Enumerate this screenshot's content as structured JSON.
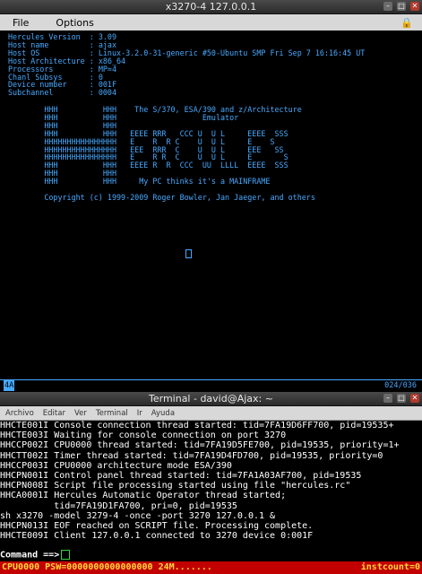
{
  "x3270": {
    "title": "x3270-4 127.0.0.1",
    "menu": [
      "File",
      "Options"
    ],
    "lock_icon": "lock-icon",
    "screen_lines": [
      "Hercules Version  : 3.09",
      "Host name         : ajax",
      "Host OS           : Linux-3.2.0-31-generic #50-Ubuntu SMP Fri Sep 7 16:16:45 UT",
      "Host Architecture : x86_64",
      "Processors        : MP=4",
      "Chanl Subsys      : 0",
      "Device number     : 001F",
      "Subchannel        : 0004",
      "",
      "        HHH          HHH    The S/370, ESA/390 and z/Architecture",
      "        HHH          HHH                   Emulator",
      "        HHH          HHH",
      "        HHH          HHH   EEEE RRR   CCC U  U L     EEEE  SSS",
      "        HHHHHHHHHHHHHHHH   E    R  R C    U  U L     E    S",
      "        HHHHHHHHHHHHHHHH   EEE  RRR  C    U  U L     EEE   SS",
      "        HHHHHHHHHHHHHHHH   E    R R  C    U  U L     E       S",
      "        HHH          HHH   EEEE R  R  CCC  UU  LLLL  EEEE  SSS",
      "        HHH          HHH",
      "        HHH          HHH     My PC thinks it's a MAINFRAME",
      "",
      "        Copyright (c) 1999-2009 Roger Bowler, Jan Jaeger, and others"
    ],
    "oia_left": "4A",
    "oia_right": "024/036"
  },
  "terminal": {
    "title": "Terminal - david@Ajax: ~",
    "menu": [
      "Archivo",
      "Editar",
      "Ver",
      "Terminal",
      "Ir",
      "Ayuda"
    ],
    "lines": [
      "HHCTE001I Console connection thread started: tid=7FA19D6FF700, pid=19535+",
      "HHCTE003I Waiting for console connection on port 3270",
      "HHCCP002I CPU0000 thread started: tid=7FA19D5FE700, pid=19535, priority=1+",
      "HHCTT002I Timer thread started: tid=7FA19D4FD700, pid=19535, priority=0",
      "HHCCP003I CPU0000 architecture mode ESA/390",
      "HHCPN001I Control panel thread started: tid=7FA1A03AF700, pid=19535",
      "HHCPN008I Script file processing started using file \"hercules.rc\"",
      "HHCA0001I Hercules Automatic Operator thread started;",
      "          tid=7FA19D1FA700, pri=0, pid=19535",
      "sh x3270 -model 3279-4 -once -port 3270 127.0.0.1 &",
      "HHCPN013I EOF reached on SCRIPT file. Processing complete.",
      "HHCTE009I Client 127.0.0.1 connected to 3270 device 0:001F"
    ],
    "command_prompt": "Command ==>",
    "status_left": "CPU0000 PSW=0000000000000000 24M.......",
    "status_right": "instcount=0"
  }
}
